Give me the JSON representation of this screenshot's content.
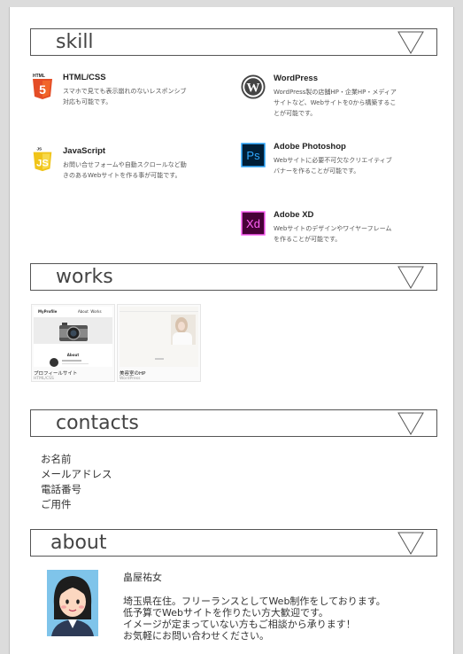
{
  "sections": {
    "skill": {
      "title": "skill"
    },
    "works": {
      "title": "works"
    },
    "contacts": {
      "title": "contacts"
    },
    "about": {
      "title": "about"
    }
  },
  "skills": [
    {
      "name": "HTML/CSS",
      "icon": "html5-icon",
      "desc": "スマホで見ても表示崩れのないレスポンシブ対応も可能です。",
      "color": "#e44d26"
    },
    {
      "name": "WordPress",
      "icon": "wordpress-icon",
      "desc": "WordPress製の店舗HP・企業HP・メディアサイトなど、Webサイトを0から構築することが可能です。",
      "color": "#333333"
    },
    {
      "name": "JavaScript",
      "icon": "javascript-icon",
      "desc": "お問い合せフォームや自動スクロールなど動きのあるWebサイトを作る事が可能です。",
      "color": "#f0c419"
    },
    {
      "name": "Adobe Photoshop",
      "icon": "photoshop-icon",
      "desc": "Webサイトに必要不可欠なクリエイティブバナーを作ることが可能です。",
      "color": "#31a8ff"
    },
    {
      "name": "Adobe XD",
      "icon": "xd-icon",
      "desc": "Webサイトのデザインやワイヤーフレームを作ることが可能です。",
      "color": "#ff61f6"
    }
  ],
  "works": [
    {
      "title": "プロフィールサイト",
      "tag": "HTML/CSS",
      "thumb": {
        "brand": "MyProfile",
        "nav": "About  Works",
        "heading": "About"
      }
    },
    {
      "title": "美容室のHP",
      "tag": "WordPress"
    }
  ],
  "contacts": [
    "お名前",
    "メールアドレス",
    "電話番号",
    "ご用件"
  ],
  "about": {
    "name": "畠屋祐女",
    "lines": [
      "埼玉県在住。フリーランスとしてWeb制作をしております。",
      "低予算でWebサイトを作りたい方大歓迎です。",
      "イメージが定まっていない方もご相談から承ります！",
      "お気軽にお問い合わせください。"
    ]
  }
}
